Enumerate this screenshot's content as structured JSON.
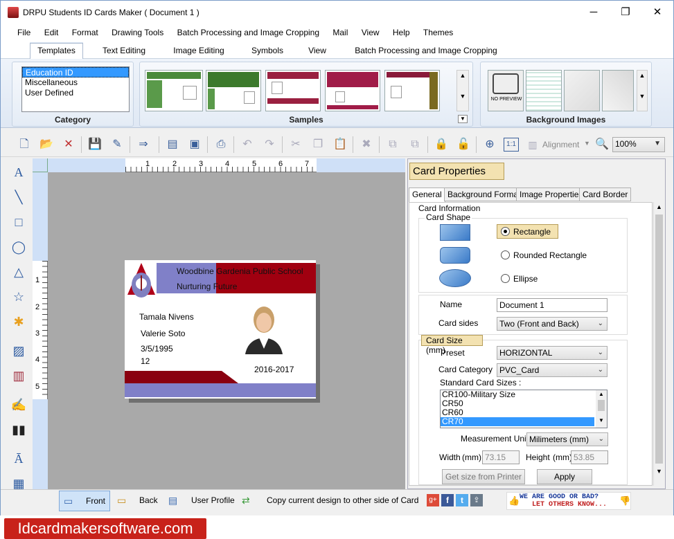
{
  "window": {
    "title": "DRPU Students ID Cards Maker ( Document 1 )",
    "minimize": "─",
    "maximize": "❐",
    "close": "✕"
  },
  "menu": [
    "File",
    "Edit",
    "Format",
    "Drawing Tools",
    "Batch Processing and Image Cropping",
    "Mail",
    "View",
    "Help",
    "Themes"
  ],
  "tabs": [
    "Templates",
    "Text Editing",
    "Image Editing",
    "Symbols",
    "View",
    "Batch Processing and Image Cropping"
  ],
  "ribbon": {
    "category_label": "Category",
    "category_items": [
      "Education ID",
      "Miscellaneous",
      "User Defined"
    ],
    "samples_label": "Samples",
    "background_label": "Background Images",
    "no_preview": "NO PREVIEW"
  },
  "toolbar": {
    "alignment": "Alignment",
    "zoom": "100%",
    "actual_size": "1:1"
  },
  "ruler": {
    "h": [
      "1",
      "2",
      "3",
      "4",
      "5",
      "6",
      "7"
    ],
    "v": [
      "1",
      "2",
      "3",
      "4",
      "5"
    ]
  },
  "card": {
    "school": "Woodbine Gardenia Public School",
    "motto": "Nurturing Future",
    "name": "Tamala Nivens",
    "parent": "Valerie Soto",
    "dob": "3/5/1995",
    "grade": "12",
    "session": "2016-2017",
    "colors": {
      "red": "#a00010",
      "purple": "#8080c8"
    }
  },
  "props": {
    "title": "Card Properties",
    "tabs": [
      "General",
      "Background Format",
      "Image Properties",
      "Card Border"
    ],
    "card_info": "Card Information",
    "card_shape": "Card Shape",
    "shapes": [
      "Rectangle",
      "Rounded Rectangle",
      "Ellipse"
    ],
    "name_label": "Name",
    "name_value": "Document 1",
    "sides_label": "Card sides",
    "sides_value": "Two (Front and Back)",
    "size_title": "Card Size (mm)",
    "preset_label": "Preset",
    "preset_value": "HORIZONTAL",
    "category_label": "Card Category",
    "category_value": "PVC_Card",
    "std_label": "Standard Card Sizes :",
    "std_sizes": [
      "CR100-Military Size",
      "CR50",
      "CR60",
      "CR70"
    ],
    "measure_label": "Measurement Unit :",
    "measure_value": "Milimeters (mm)",
    "width_label": "Width",
    "height_label": "Height",
    "mm": "(mm)",
    "width_value": "73.15",
    "height_value": "53.85",
    "get_size": "Get size from Printer",
    "apply": "Apply"
  },
  "status": {
    "front": "Front",
    "back": "Back",
    "user_profile": "User Profile",
    "copy": "Copy current design to other side of Card",
    "feedback_1": "WE ARE GOOD OR BAD?",
    "feedback_2": "LET OTHERS KNOW..."
  },
  "site": "Idcardmakersoftware.com"
}
